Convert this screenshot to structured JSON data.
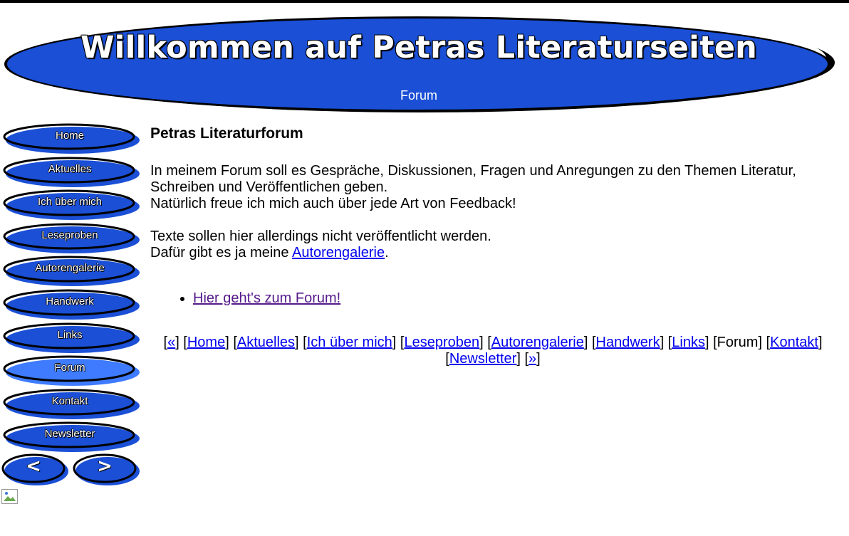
{
  "header": {
    "title": "Willkommen auf Petras Literaturseiten",
    "subtitle": "Forum"
  },
  "colors": {
    "accent_blue": "#1a4fd6",
    "active_blue": "#3e7bff",
    "link": "#0000ee",
    "visited_link": "#551a8b"
  },
  "sidebar": {
    "items": [
      {
        "label": "Home",
        "active": false
      },
      {
        "label": "Aktuelles",
        "active": false
      },
      {
        "label": "Ich über mich",
        "active": false
      },
      {
        "label": "Leseproben",
        "active": false
      },
      {
        "label": "Autorengalerie",
        "active": false
      },
      {
        "label": "Handwerk",
        "active": false
      },
      {
        "label": "Links",
        "active": false
      },
      {
        "label": "Forum",
        "active": true
      },
      {
        "label": "Kontakt",
        "active": false
      },
      {
        "label": "Newsletter",
        "active": false
      }
    ],
    "prev_glyph": "<",
    "next_glyph": ">"
  },
  "main": {
    "heading": "Petras Literaturforum",
    "para1_line1": "In meinem Forum soll es Gespräche, Diskussionen, Fragen und Anregungen zu den Themen Literatur, Schreiben und Veröffentlichen geben.",
    "para1_line2": "Natürlich freue ich mich auch über jede Art von Feedback!",
    "para2_line1": "Texte sollen hier allerdings nicht veröffentlicht werden.",
    "para2_prefix": "Dafür gibt es ja meine ",
    "para2_link": "Autorengalerie",
    "para2_suffix": ".",
    "forum_link": "Hier geht's zum Forum!"
  },
  "footer_nav": {
    "prev": "«",
    "home": "Home",
    "aktuelles": "Aktuelles",
    "ich": "Ich über mich",
    "leseproben": "Leseproben",
    "autorengalerie": "Autorengalerie",
    "handwerk": "Handwerk",
    "links": "Links",
    "forum": "Forum",
    "kontakt": "Kontakt",
    "newsletter": "Newsletter",
    "next": "»"
  }
}
